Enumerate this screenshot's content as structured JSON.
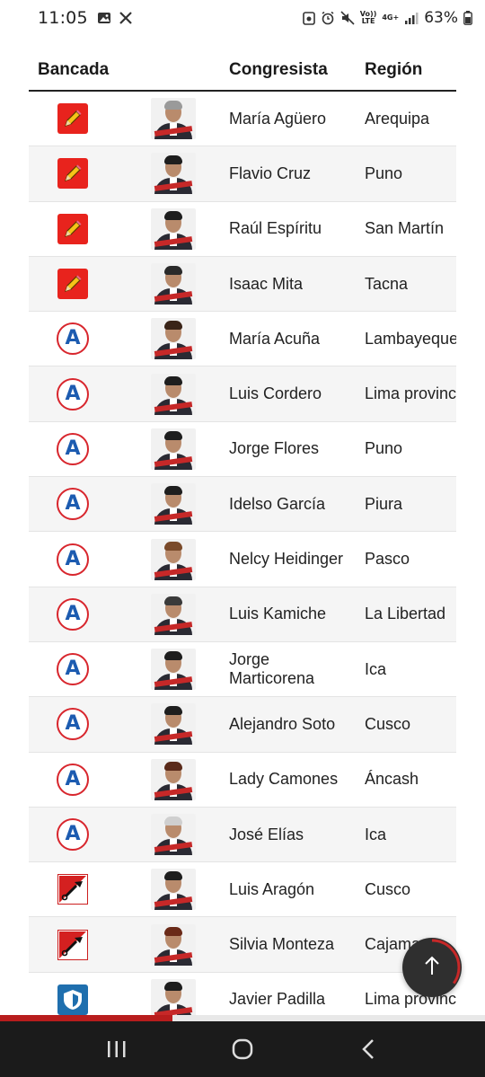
{
  "status_bar": {
    "time": "11:05",
    "battery_text": "63%",
    "network_label_top": "Vo))",
    "network_label_bottom": "LTE",
    "network_type": "4G+",
    "icons": [
      "image-icon",
      "x-icon",
      "screenshot-icon",
      "alarm-icon",
      "mute-icon",
      "signal-icon",
      "battery-icon"
    ]
  },
  "table": {
    "headers": {
      "bancada": "Bancada",
      "congresista": "Congresista",
      "region": "Región"
    },
    "rows": [
      {
        "party": "fp",
        "name": "María Agüero",
        "region": "Arequipa"
      },
      {
        "party": "fp",
        "name": "Flavio Cruz",
        "region": "Puno"
      },
      {
        "party": "fp",
        "name": "Raúl Espíritu",
        "region": "San Martín"
      },
      {
        "party": "fp",
        "name": "Isaac Mita",
        "region": "Tacna"
      },
      {
        "party": "app",
        "name": "María Acuña",
        "region": "Lambayeque"
      },
      {
        "party": "app",
        "name": "Luis Cordero",
        "region": "Lima provincias"
      },
      {
        "party": "app",
        "name": "Jorge Flores",
        "region": "Puno"
      },
      {
        "party": "app",
        "name": "Idelso García",
        "region": "Piura"
      },
      {
        "party": "app",
        "name": "Nelcy Heidinger",
        "region": "Pasco"
      },
      {
        "party": "app",
        "name": "Luis Kamiche",
        "region": "La Libertad"
      },
      {
        "party": "app",
        "name": "Jorge Marticorena",
        "region": "Ica"
      },
      {
        "party": "app",
        "name": "Alejandro Soto",
        "region": "Cusco"
      },
      {
        "party": "app",
        "name": "Lady Camones",
        "region": "Áncash"
      },
      {
        "party": "app",
        "name": "José Elías",
        "region": "Ica"
      },
      {
        "party": "pl",
        "name": "Luis Aragón",
        "region": "Cusco"
      },
      {
        "party": "pl",
        "name": "Silvia Monteza",
        "region": "Cajamarca"
      },
      {
        "party": "hp",
        "name": "Javier Padilla",
        "region": "Lima provincias"
      }
    ]
  },
  "party_logos": {
    "fp": "pencil-icon",
    "app": "letter-a-icon",
    "pl": "shovel-icon",
    "hp": "shield-icon"
  },
  "app_logo_letter": "A",
  "scroll_top": {
    "icon": "arrow-up-icon",
    "progress": 0.35
  },
  "reading_progress": 0.355,
  "nav_bar": {
    "icons": [
      "recent-apps-icon",
      "home-icon",
      "back-icon"
    ]
  },
  "colors": {
    "accent_red": "#b81d1d",
    "fp_red": "#e8231d",
    "app_blue": "#1c5bb0",
    "hp_blue": "#1f6fae"
  }
}
